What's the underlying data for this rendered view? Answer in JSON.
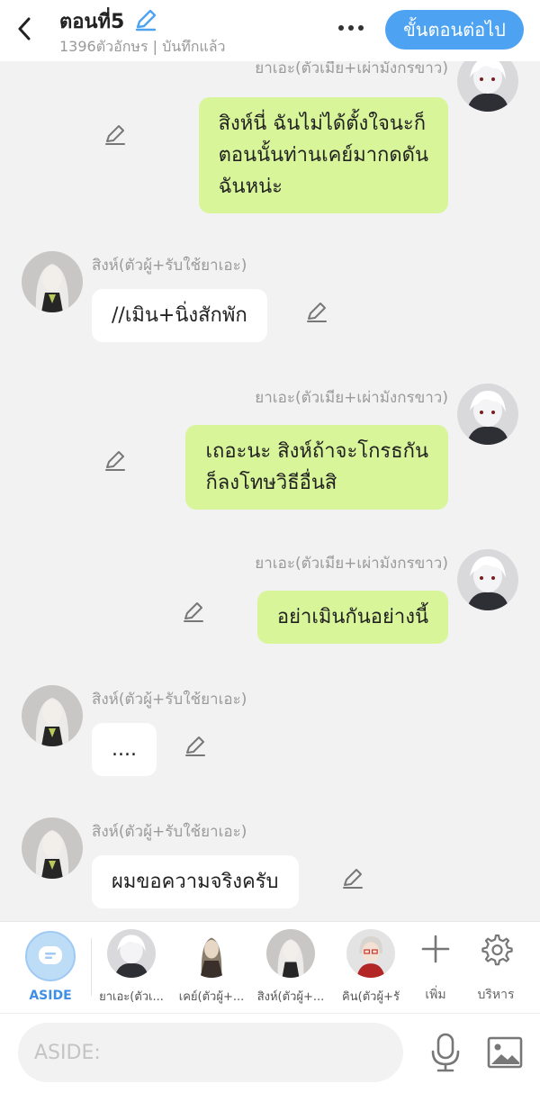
{
  "header": {
    "title": "ตอนที่5",
    "subtitle": "1396ตัวอักษร | บันทึกแล้ว",
    "next_label": "ขั้นตอนต่อไป",
    "back_icon": "chevron-left-icon",
    "edit_icon": "pencil-icon",
    "more_icon": "more-dots-icon"
  },
  "chat": {
    "messages": [
      {
        "side": "right",
        "character": "yae",
        "name": "ยาเอะ(ตัวเมีย+เผ่ามังกรขาว)",
        "lines": [
          "สิงห์นี่ ฉันไม่ได้ตั้งใจนะก็",
          "ตอนนั้นท่านเคย์มากดดัน",
          "ฉันหน่ะ"
        ]
      },
      {
        "side": "left",
        "character": "sing",
        "name": "สิงห์(ตัวผู้+รับใช้ยาเอะ)",
        "lines": [
          "//เมิน+นิ่งสักพัก"
        ]
      },
      {
        "side": "right",
        "character": "yae",
        "name": "ยาเอะ(ตัวเมีย+เผ่ามังกรขาว)",
        "lines": [
          "เถอะนะ สิงห์ถ้าจะโกรธกัน",
          "ก็ลงโทษวิธีอื่นสิ"
        ]
      },
      {
        "side": "right",
        "character": "yae",
        "name": "ยาเอะ(ตัวเมีย+เผ่ามังกรขาว)",
        "lines": [
          "อย่าเมินกันอย่างนี้"
        ]
      },
      {
        "side": "left",
        "character": "sing",
        "name": "สิงห์(ตัวผู้+รับใช้ยาเอะ)",
        "lines": [
          "...."
        ]
      },
      {
        "side": "left",
        "character": "sing",
        "name": "สิงห์(ตัวผู้+รับใช้ยาเอะ)",
        "lines": [
          "ผมขอความจริงครับ"
        ]
      }
    ]
  },
  "characters": {
    "aside_label": "ASIDE",
    "items": [
      {
        "id": "yae",
        "label": "ยาเอะ(ตัวเ..."
      },
      {
        "id": "kay",
        "label": "เคย์(ตัวผู้+..."
      },
      {
        "id": "sing",
        "label": "สิงห์(ตัวผู้+..."
      },
      {
        "id": "kin",
        "label": "คิน(ตัวผู้+รั"
      }
    ],
    "add_label": "เพิ่ม",
    "manage_label": "บริหาร"
  },
  "input": {
    "placeholder": "ASIDE:",
    "value": ""
  },
  "colors": {
    "accent": "#4da3f2",
    "bubble_right": "#d8f59a",
    "bubble_left": "#ffffff",
    "background": "#f2f2f2"
  }
}
